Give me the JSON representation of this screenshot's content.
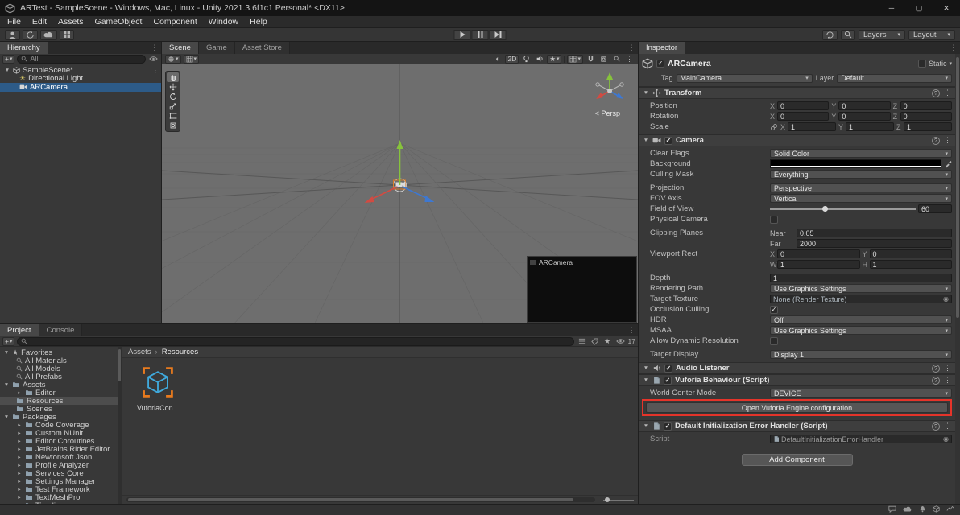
{
  "colors": {
    "selection_blue": "#2d5b88",
    "annotation_red": "#e5342a",
    "axis_x_red": "#d24b42",
    "axis_y_green": "#87c33c",
    "axis_z_blue": "#3e78d1",
    "vuforia_blue": "#3fa9dc",
    "vuforia_orange": "#e87a1e"
  },
  "icons": {
    "menu": "⋮",
    "dropdown_arrow": "▾",
    "foldout_open": "▼",
    "foldout_closed": "▸",
    "check": "✓",
    "help": "?",
    "breadcrumb_sep": "›",
    "sun": "☀",
    "star": "★",
    "object_picker": "◉",
    "plus": "+",
    "half_circle": "◐",
    "minimize": "─",
    "maximize": "▢",
    "close": "✕"
  },
  "titlebar": {
    "title": "ARTest - SampleScene - Windows, Mac, Linux - Unity 2021.3.6f1c1 Personal* <DX11>"
  },
  "menubar": [
    "File",
    "Edit",
    "Assets",
    "GameObject",
    "Component",
    "Window",
    "Help"
  ],
  "topbar": {
    "layers": "Layers",
    "layout": "Layout"
  },
  "hierarchy": {
    "tab": "Hierarchy",
    "search_text": "All",
    "scene_name": "SampleScene*",
    "children": [
      "Directional Light",
      "ARCamera"
    ]
  },
  "scene_view": {
    "tab_scene": "Scene",
    "tab_game": "Game",
    "tab_asset_store": "Asset Store",
    "toggle_2d": "2D",
    "persp_label": "< Persp",
    "camera_preview_title": "ARCamera"
  },
  "project": {
    "tab_project": "Project",
    "tab_console": "Console",
    "hidden_count": "17",
    "breadcrumb_root": "Assets",
    "breadcrumb_current": "Resources",
    "favorites_label": "Favorites",
    "favorites": [
      "All Materials",
      "All Models",
      "All Prefabs"
    ],
    "assets_label": "Assets",
    "asset_folders": [
      "Editor",
      "Resources",
      "Scenes"
    ],
    "packages_label": "Packages",
    "package_folders": [
      "Code Coverage",
      "Custom NUnit",
      "Editor Coroutines",
      "JetBrains Rider Editor",
      "Newtonsoft Json",
      "Profile Analyzer",
      "Services Core",
      "Settings Manager",
      "Test Framework",
      "TextMeshPro",
      "Timeline"
    ],
    "items": [
      {
        "label": "VuforiaCon..."
      }
    ]
  },
  "inspector": {
    "tab": "Inspector",
    "header": {
      "name": "ARCamera",
      "static_label": "Static",
      "tag_label": "Tag",
      "tag_value": "MainCamera",
      "layer_label": "Layer",
      "layer_value": "Default"
    },
    "axis": {
      "x": "X",
      "y": "Y",
      "z": "Z",
      "w": "W",
      "h": "H"
    },
    "transform": {
      "title": "Transform",
      "position_label": "Position",
      "rotation_label": "Rotation",
      "scale_label": "Scale",
      "position": {
        "x": "0",
        "y": "0",
        "z": "0"
      },
      "rotation": {
        "x": "0",
        "y": "0",
        "z": "0"
      },
      "scale": {
        "x": "1",
        "y": "1",
        "z": "1"
      }
    },
    "camera": {
      "title": "Camera",
      "clear_flags_label": "Clear Flags",
      "clear_flags": "Solid Color",
      "background_label": "Background",
      "culling_mask_label": "Culling Mask",
      "culling_mask": "Everything",
      "projection_label": "Projection",
      "projection": "Perspective",
      "fov_axis_label": "FOV Axis",
      "fov_axis": "Vertical",
      "fov_label": "Field of View",
      "fov": "60",
      "physical_label": "Physical Camera",
      "clipping_label": "Clipping Planes",
      "near_label": "Near",
      "near": "0.05",
      "far_label": "Far",
      "far": "2000",
      "viewport_label": "Viewport Rect",
      "viewport": {
        "x": "0",
        "y": "0",
        "w": "1",
        "h": "1"
      },
      "depth_label": "Depth",
      "depth": "1",
      "rendering_path_label": "Rendering Path",
      "rendering_path": "Use Graphics Settings",
      "target_texture_label": "Target Texture",
      "target_texture": "None (Render Texture)",
      "occlusion_label": "Occlusion Culling",
      "hdr_label": "HDR",
      "hdr": "Off",
      "msaa_label": "MSAA",
      "msaa": "Use Graphics Settings",
      "dynamic_res_label": "Allow Dynamic Resolution",
      "target_display_label": "Target Display",
      "target_display": "Display 1"
    },
    "audio": {
      "title": "Audio Listener"
    },
    "vuforia": {
      "title": "Vuforia Behaviour (Script)",
      "world_center_label": "World Center Mode",
      "world_center": "DEVICE",
      "config_button": "Open Vuforia Engine configuration"
    },
    "error_handler": {
      "title": "Default Initialization Error Handler (Script)",
      "script_label": "Script",
      "script_value": "DefaultInitializationErrorHandler"
    },
    "add_component": "Add Component"
  }
}
